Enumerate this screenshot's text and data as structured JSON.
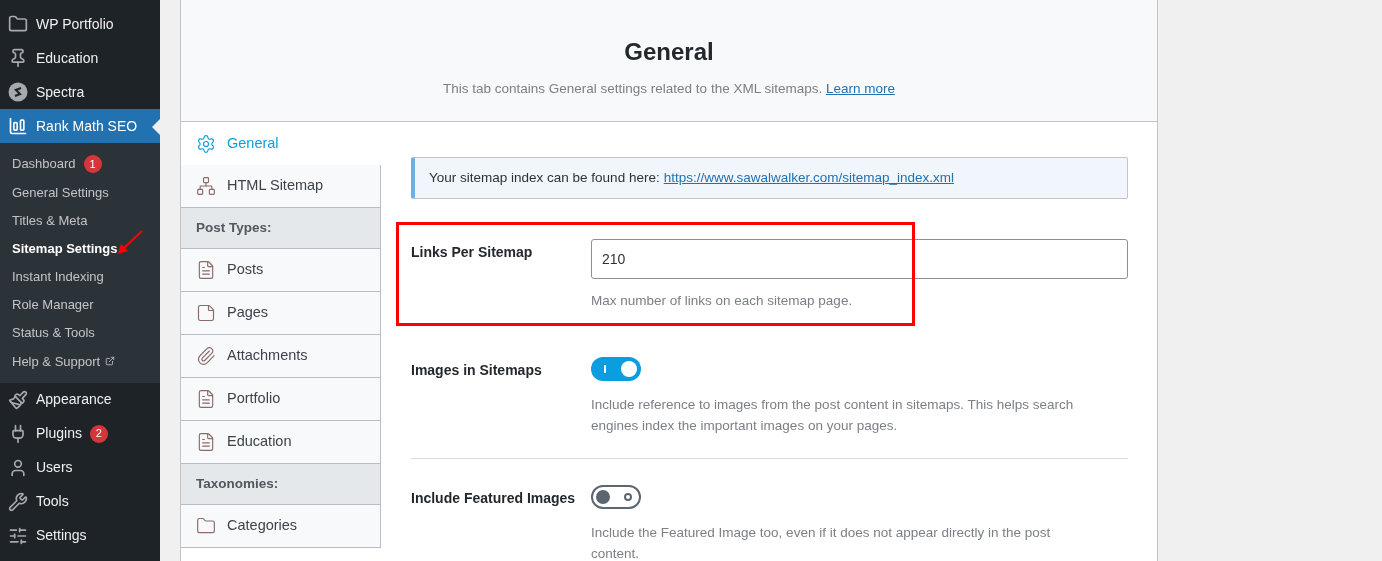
{
  "sidebar": {
    "menu": [
      {
        "label": "WP Portfolio",
        "selected": false
      },
      {
        "label": "Education",
        "selected": false
      },
      {
        "label": "Spectra",
        "selected": false
      },
      {
        "label": "Rank Math SEO",
        "selected": true,
        "children": [
          {
            "label": "Dashboard",
            "selected": false,
            "badge": "1"
          },
          {
            "label": "General Settings",
            "selected": false
          },
          {
            "label": "Titles & Meta",
            "selected": false
          },
          {
            "label": "Sitemap Settings",
            "selected": true,
            "annotated": true
          },
          {
            "label": "Instant Indexing",
            "selected": false
          },
          {
            "label": "Role Manager",
            "selected": false
          },
          {
            "label": "Status & Tools",
            "selected": false
          },
          {
            "label": "Help & Support",
            "selected": false,
            "external": true
          }
        ]
      },
      {
        "label": "Appearance",
        "selected": false
      },
      {
        "label": "Plugins",
        "selected": false,
        "badge": "2"
      },
      {
        "label": "Users",
        "selected": false
      },
      {
        "label": "Tools",
        "selected": false
      },
      {
        "label": "Settings",
        "selected": false
      }
    ]
  },
  "header": {
    "title": "General",
    "subtitle": "This tab contains General settings related to the XML sitemaps.",
    "link": "Learn more"
  },
  "tabs": [
    {
      "kind": "tab",
      "label": "General",
      "selected": true
    },
    {
      "kind": "tab",
      "label": "HTML Sitemap",
      "selected": false
    },
    {
      "kind": "heading",
      "label": "Post Types:"
    },
    {
      "kind": "tab",
      "label": "Posts",
      "selected": false
    },
    {
      "kind": "tab",
      "label": "Pages",
      "selected": false
    },
    {
      "kind": "tab",
      "label": "Attachments",
      "selected": false
    },
    {
      "kind": "tab",
      "label": "Portfolio",
      "selected": false
    },
    {
      "kind": "tab",
      "label": "Education",
      "selected": false
    },
    {
      "kind": "heading",
      "label": "Taxonomies:"
    },
    {
      "kind": "tab",
      "label": "Categories",
      "selected": false
    }
  ],
  "notice": {
    "text": "Your sitemap index can be found here:",
    "link": "https://www.sawalwalker.com/sitemap_index.xml"
  },
  "fields": [
    {
      "kind": "text",
      "label": "Links Per Sitemap",
      "value": "210",
      "description": "Max number of links on each sitemap page.",
      "highlighted": true
    },
    {
      "kind": "toggle",
      "label": "Images in Sitemaps",
      "on": true,
      "description": "Include reference to images from the post content in sitemaps. This helps search engines index the important images on your pages."
    },
    {
      "kind": "toggle",
      "label": "Include Featured Images",
      "on": false,
      "description": "Include the Featured Image too, even if it does not appear directly in the post content."
    }
  ]
}
